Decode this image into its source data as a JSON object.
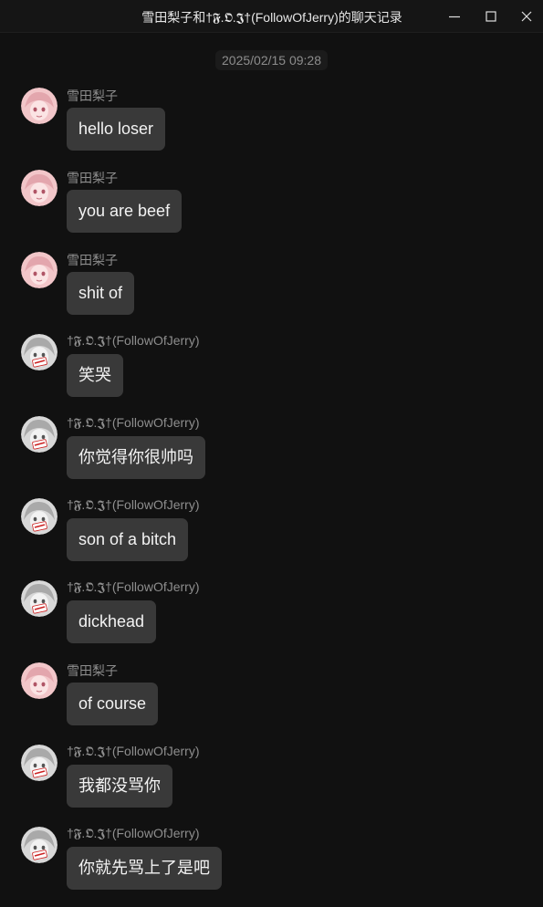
{
  "window": {
    "title": "雪田梨子和†𝕱.𝕺.𝕵†(FollowOfJerry)的聊天记录"
  },
  "timestamp": "2025/02/15 09:28",
  "messages": [
    {
      "sender": "雪田梨子",
      "avatar": "pink-anime-avatar",
      "text": "hello loser"
    },
    {
      "sender": "雪田梨子",
      "avatar": "pink-anime-avatar",
      "text": "you are beef"
    },
    {
      "sender": "雪田梨子",
      "avatar": "pink-anime-avatar",
      "text": "shit of"
    },
    {
      "sender": "†𝕱.𝕺.𝕵†(FollowOfJerry)",
      "avatar": "gray-anime-avatar",
      "text": "笑哭"
    },
    {
      "sender": "†𝕱.𝕺.𝕵†(FollowOfJerry)",
      "avatar": "gray-anime-avatar",
      "text": "你觉得你很帅吗"
    },
    {
      "sender": "†𝕱.𝕺.𝕵†(FollowOfJerry)",
      "avatar": "gray-anime-avatar",
      "text": "son of a bitch"
    },
    {
      "sender": "†𝕱.𝕺.𝕵†(FollowOfJerry)",
      "avatar": "gray-anime-avatar",
      "text": "dickhead"
    },
    {
      "sender": "雪田梨子",
      "avatar": "pink-anime-avatar",
      "text": "of course"
    },
    {
      "sender": "†𝕱.𝕺.𝕵†(FollowOfJerry)",
      "avatar": "gray-anime-avatar",
      "text": "我都没骂你"
    },
    {
      "sender": "†𝕱.𝕺.𝕵†(FollowOfJerry)",
      "avatar": "gray-anime-avatar",
      "text": "你就先骂上了是吧"
    }
  ],
  "colors": {
    "background": "#111111",
    "bubble": "#393939",
    "sender_text": "#8e8e8e",
    "pink_avatar": "#f2c6c9",
    "gray_avatar": "#d8d8d8",
    "avatar_badge": "#cc2222"
  }
}
